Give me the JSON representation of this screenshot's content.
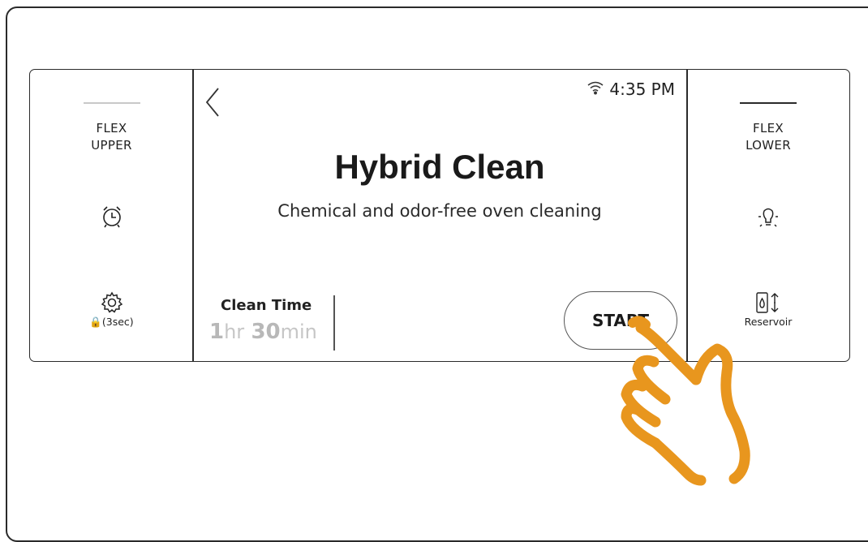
{
  "left_panel": {
    "mode_label": "FLEX\nUPPER",
    "timer_icon": "alarm-clock-icon",
    "settings_icon": "gear-icon",
    "lock_caption": "🔒(3sec)"
  },
  "center": {
    "status_time": "4:35 PM",
    "title": "Hybrid Clean",
    "subtitle": "Chemical and odor-free oven cleaning",
    "clean_time_label": "Clean Time",
    "clean_time": {
      "hours": "1",
      "hours_unit": "hr",
      "minutes": "30",
      "minutes_unit": "min"
    },
    "start_label": "START"
  },
  "right_panel": {
    "mode_label": "FLEX\nLOWER",
    "light_icon": "oven-light-icon",
    "reservoir_label": "Reservoir"
  },
  "colors": {
    "frame": "#2a2a2a",
    "hand": "#e8961e",
    "time_text": "#bdbdbd"
  }
}
